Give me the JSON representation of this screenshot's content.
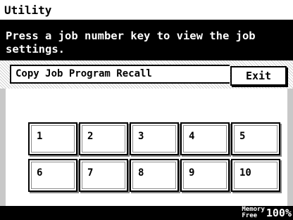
{
  "title": "Utility",
  "message": "Press a job number key to view the job\nsettings.",
  "section_label": "Copy Job Program Recall",
  "exit_label": "Exit",
  "job_keys": [
    "1",
    "2",
    "3",
    "4",
    "5",
    "6",
    "7",
    "8",
    "9",
    "10"
  ],
  "memory": {
    "label_line1": "Memory",
    "label_line2": "Free",
    "value": "100%"
  }
}
